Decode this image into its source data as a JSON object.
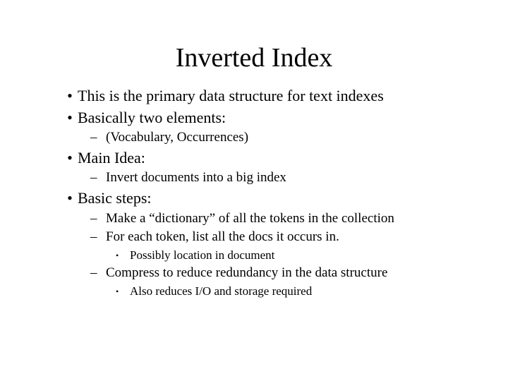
{
  "title": "Inverted Index",
  "b0": "This is the primary data structure for text indexes",
  "b1": "Basically two elements:",
  "b1_s0": "(Vocabulary, Occurrences)",
  "b2": "Main Idea:",
  "b2_s0": "Invert documents into a big index",
  "b3": "Basic steps:",
  "b3_s0": "Make a “dictionary” of all the tokens in the collection",
  "b3_s1": "For each token, list all the docs it occurs in.",
  "b3_s1_t0": "Possibly location in document",
  "b3_s2": "Compress to reduce redundancy in the data structure",
  "b3_s2_t0": "Also reduces I/O and storage required"
}
